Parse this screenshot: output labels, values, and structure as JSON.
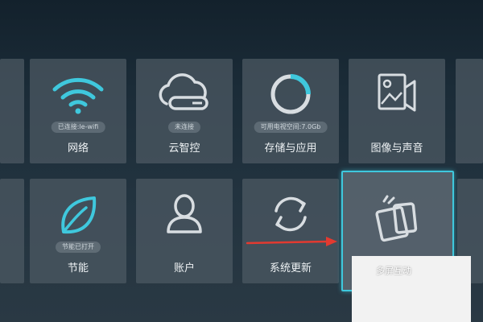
{
  "colors": {
    "accent": "#3fc8dd",
    "icon_gray": "#d8dde1",
    "arrow_red": "#e23a30",
    "badge_bg": "#8e9aa2"
  },
  "tiles": {
    "network": {
      "label": "网络",
      "status": "已连接:le-wifi",
      "icon": "wifi-icon"
    },
    "cloud": {
      "label": "云智控",
      "status": "未连接",
      "icon": "cloud-icon"
    },
    "storage": {
      "label": "存储与应用",
      "status": "可用电视空间:7.0Gb",
      "icon": "storage-ring-icon"
    },
    "image_sound": {
      "label": "图像与声音",
      "icon": "image-sound-icon"
    },
    "energy": {
      "label": "节能",
      "status": "节能已打开",
      "icon": "leaf-icon"
    },
    "account": {
      "label": "账户",
      "icon": "user-icon"
    },
    "update": {
      "label": "系统更新",
      "icon": "refresh-icon"
    },
    "multiscreen": {
      "label": "多屏互动",
      "icon": "multiscreen-icon"
    }
  }
}
